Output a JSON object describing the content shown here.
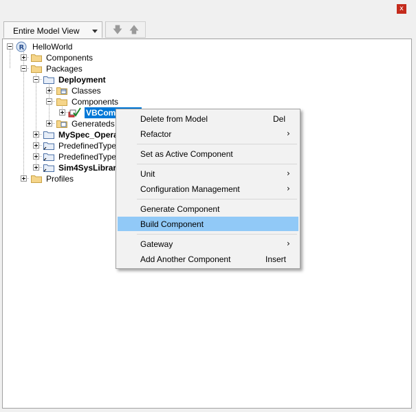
{
  "window": {
    "close_glyph": "x"
  },
  "toolbar": {
    "view_label": "Entire Model View",
    "down_glyph": "🡇",
    "up_glyph": "🡅"
  },
  "tree": {
    "root": "HelloWorld",
    "components": "Components",
    "packages": "Packages",
    "deployment": "Deployment",
    "classes": "Classes",
    "dep_components": "Components",
    "selected": "VBComp",
    "generateds": "Generateds",
    "myspec": "MySpec_Opera",
    "predef1": "PredefinedType",
    "predef2": "PredefinedType",
    "sim4sys": "Sim4SysLibrari",
    "profiles": "Profiles"
  },
  "menu": {
    "items": [
      {
        "label": "Delete from Model",
        "shortcut": "Del"
      },
      {
        "label": "Refactor",
        "shortcut": "",
        "submenu": true
      },
      {
        "label": "Set as Active Component",
        "shortcut": ""
      },
      {
        "label": "Unit",
        "shortcut": "",
        "submenu": true
      },
      {
        "label": "Configuration Management",
        "shortcut": "",
        "submenu": true
      },
      {
        "label": "Generate Component",
        "shortcut": ""
      },
      {
        "label": "Build Component",
        "shortcut": ""
      },
      {
        "label": "Gateway",
        "shortcut": "",
        "submenu": true
      },
      {
        "label": "Add Another Component",
        "shortcut": "Insert"
      }
    ],
    "submenu_glyph": "›",
    "highlighted": "Build Component"
  },
  "colors": {
    "selection": "#0078d7",
    "menu_highlight": "#91c9f7",
    "folder": "#f5d58a"
  }
}
